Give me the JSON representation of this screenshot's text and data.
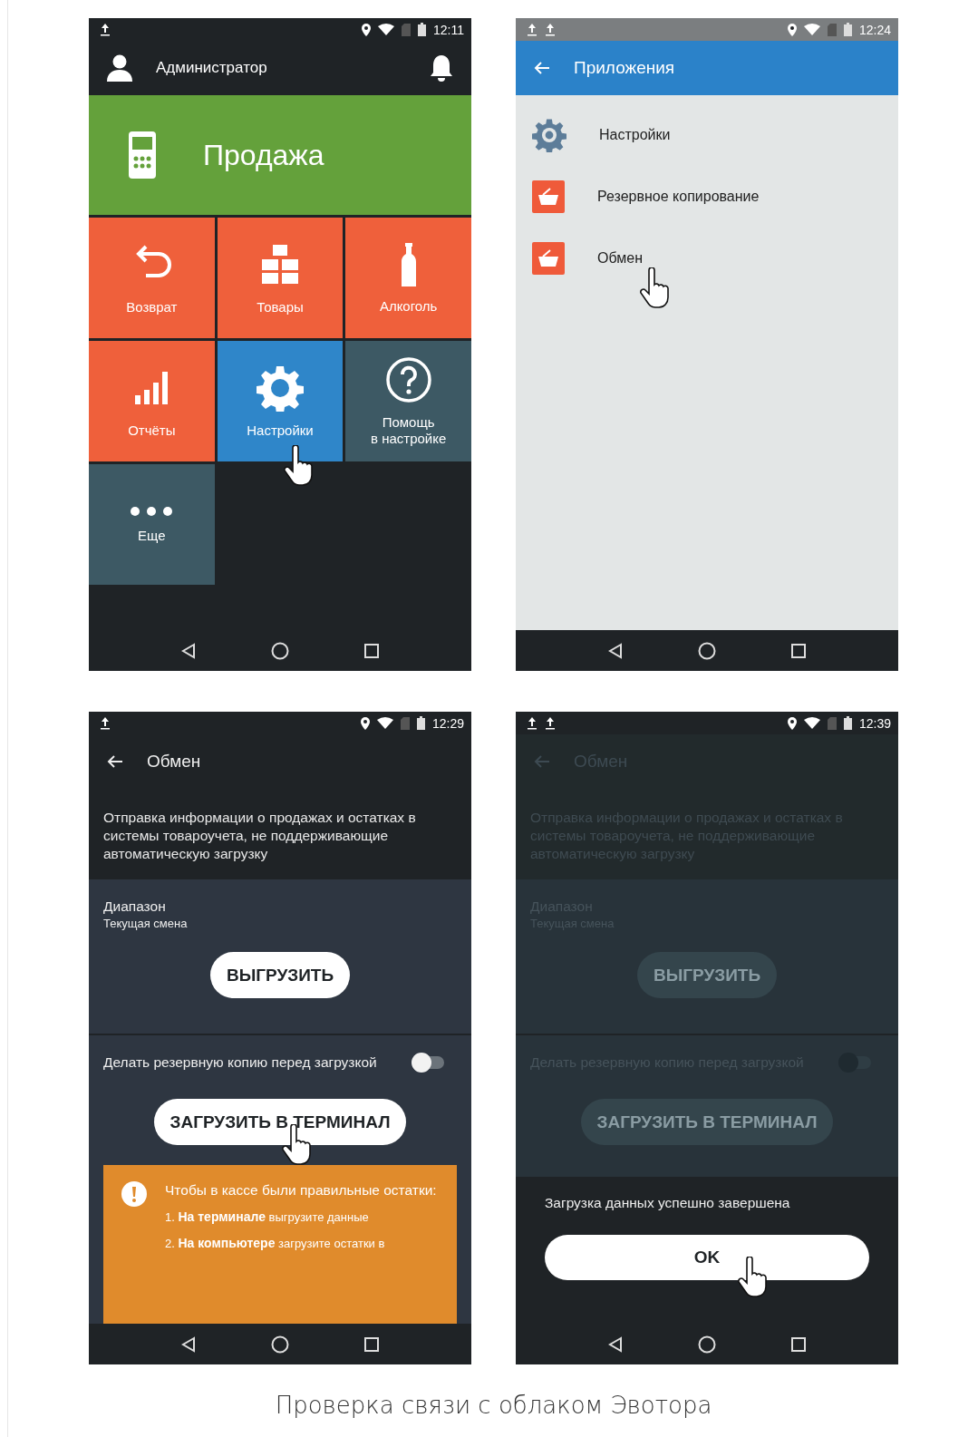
{
  "screens": [
    {
      "kind": "home",
      "time": "12:11",
      "user": "Администратор",
      "sale": "Продажа",
      "tiles": [
        {
          "kind": "return",
          "label": "Возврат",
          "color": "#ef603b",
          "touched": false
        },
        {
          "kind": "goods",
          "label": "Товары",
          "color": "#ef603b",
          "touched": false
        },
        {
          "kind": "bottle",
          "label": "Алкоголь",
          "color": "#ef603b",
          "touched": false
        },
        {
          "kind": "reports",
          "label": "Отчёты",
          "color": "#ef603b",
          "touched": false
        },
        {
          "kind": "settings",
          "label": "Настройки",
          "color": "#2f86c9",
          "touched": true
        },
        {
          "kind": "help",
          "label": "Помощь\nв настройке",
          "color": "#3d5964",
          "touched": false
        },
        {
          "kind": "more",
          "label": "Еще",
          "color": "#3d5964",
          "touched": false
        }
      ]
    },
    {
      "kind": "apps",
      "time": "12:24",
      "title": "Приложения",
      "items": [
        {
          "kind": "gear",
          "label": "Настройки",
          "touched": false
        },
        {
          "kind": "basket",
          "label": "Резервное копирование",
          "touched": false
        },
        {
          "kind": "basket",
          "label": "Обмен",
          "touched": true
        }
      ]
    },
    {
      "kind": "exchange",
      "dimmed": false,
      "time": "12:29",
      "title": "Обмен",
      "description": "Отправка информации о продажах и остатках в системы товароучета, не поддерживающие автоматическую загрузку",
      "range_label": "Диапазон",
      "range_value": "Текущая смена",
      "export_button": "ВЫГРУЗИТЬ",
      "backup_label": "Делать резервную копию перед загрузкой",
      "backup_on": false,
      "import_button": "ЗАГРУЗИТЬ В ТЕРМИНАЛ",
      "import_touched": true,
      "warning": {
        "title": "Чтобы в кассе были правильные остатки:",
        "steps": [
          "1. **На терминале** выгрузите данные",
          "2. **На компьютере** загрузите остатки в"
        ]
      }
    },
    {
      "kind": "exchange",
      "dimmed": true,
      "time": "12:39",
      "title": "Обмен",
      "description": "Отправка информации о продажах и остатках в системы товароучета, не поддерживающие автоматическую загрузку",
      "range_label": "Диапазон",
      "range_value": "Текущая смена",
      "export_button": "ВЫГРУЗИТЬ",
      "backup_label": "Делать резервную копию перед загрузкой",
      "backup_on": false,
      "import_button": "ЗАГРУЗИТЬ В ТЕРМИНАЛ",
      "import_touched": false,
      "dialog": {
        "message": "Загрузка данных успешно завершена",
        "button": "OK",
        "touched": true
      }
    }
  ],
  "caption": "Проверка связи с облаком Эвотора"
}
